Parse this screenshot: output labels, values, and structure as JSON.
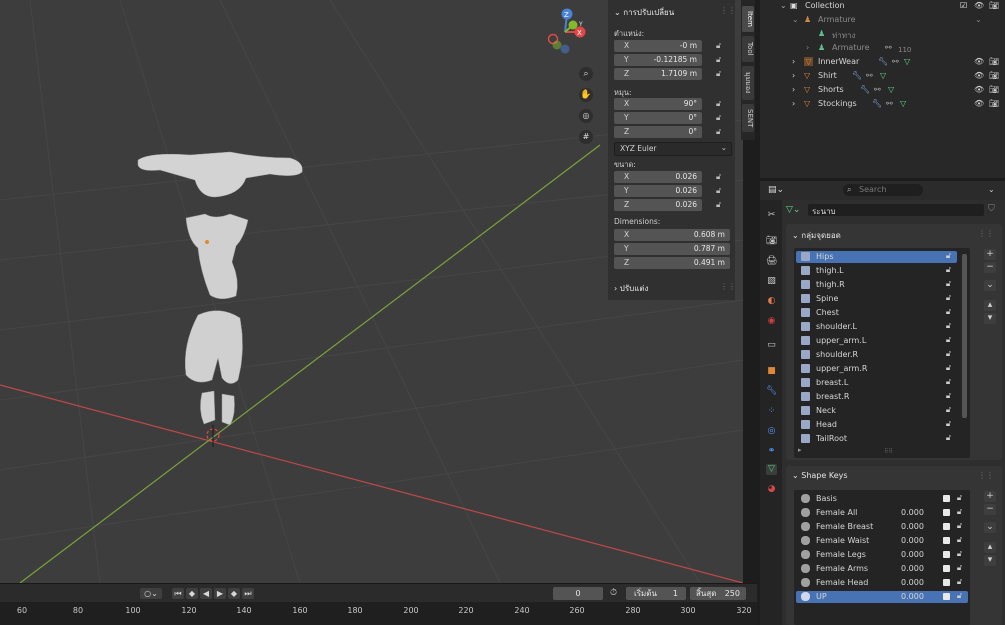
{
  "npanel": {
    "section_transform": "การปรับเปลี่ยน",
    "location_label": "ตำแหน่ง:",
    "location": [
      {
        "axis": "X",
        "value": "-0 m"
      },
      {
        "axis": "Y",
        "value": "-0.12185 m"
      },
      {
        "axis": "Z",
        "value": "1.7109 m"
      }
    ],
    "rotation_label": "หมุน:",
    "rotation": [
      {
        "axis": "X",
        "value": "90°"
      },
      {
        "axis": "Y",
        "value": "0°"
      },
      {
        "axis": "Z",
        "value": "0°"
      }
    ],
    "rotation_mode": "XYZ Euler",
    "scale_label": "ขนาด:",
    "scale": [
      {
        "axis": "X",
        "value": "0.026"
      },
      {
        "axis": "Y",
        "value": "0.026"
      },
      {
        "axis": "Z",
        "value": "0.026"
      }
    ],
    "dimensions_label": "Dimensions:",
    "dimensions": [
      {
        "axis": "X",
        "value": "0.608 m"
      },
      {
        "axis": "Y",
        "value": "0.787 m"
      },
      {
        "axis": "Z",
        "value": "0.491 m"
      }
    ],
    "section_custom": "ปรับแต่ง"
  },
  "vtabs": [
    "Item",
    "Tool",
    "มุมมอง",
    "SENT"
  ],
  "gizmo": {
    "x": "X",
    "y": "Y",
    "z": "Z"
  },
  "timeline": {
    "current_frame": "0",
    "start_label": "เริ่มต้น",
    "start": "1",
    "end_label": "สิ้นสุด",
    "end": "250",
    "ruler": [
      "60",
      "80",
      "100",
      "120",
      "140",
      "160",
      "180",
      "200",
      "220",
      "240",
      "260",
      "280",
      "300",
      "320"
    ]
  },
  "outliner": {
    "collection": "Collection",
    "rows": [
      {
        "name": "Armature"
      },
      {
        "name": "ท่าทาง"
      },
      {
        "name": "Armature",
        "count": "110"
      },
      {
        "name": "InnerWear"
      },
      {
        "name": "Shirt"
      },
      {
        "name": "Shorts"
      },
      {
        "name": "Stockings"
      }
    ]
  },
  "props": {
    "search_placeholder": "Search",
    "mesh_name": "ระนาบ",
    "vgroups_title": "กลุ่มจุดยอด",
    "vgroups": [
      "Hips",
      "thigh.L",
      "thigh.R",
      "Spine",
      "Chest",
      "shoulder.L",
      "upper_arm.L",
      "shoulder.R",
      "upper_arm.R",
      "breast.L",
      "breast.R",
      "Neck",
      "Head",
      "TailRoot"
    ],
    "shapekeys_title": "Shape Keys",
    "shapekeys": [
      {
        "name": "Basis",
        "value": ""
      },
      {
        "name": "Female All",
        "value": "0.000"
      },
      {
        "name": "Female Breast",
        "value": "0.000"
      },
      {
        "name": "Female Waist",
        "value": "0.000"
      },
      {
        "name": "Female Legs",
        "value": "0.000"
      },
      {
        "name": "Female Arms",
        "value": "0.000"
      },
      {
        "name": "Female Head",
        "value": "0.000"
      },
      {
        "name": "UP",
        "value": "0.000"
      }
    ]
  },
  "colors": {
    "accent": "#4772b3",
    "x_axis": "#e04848",
    "y_axis": "#83b92a",
    "z_axis": "#4a82d6",
    "mesh_icon": "#e0883a"
  }
}
